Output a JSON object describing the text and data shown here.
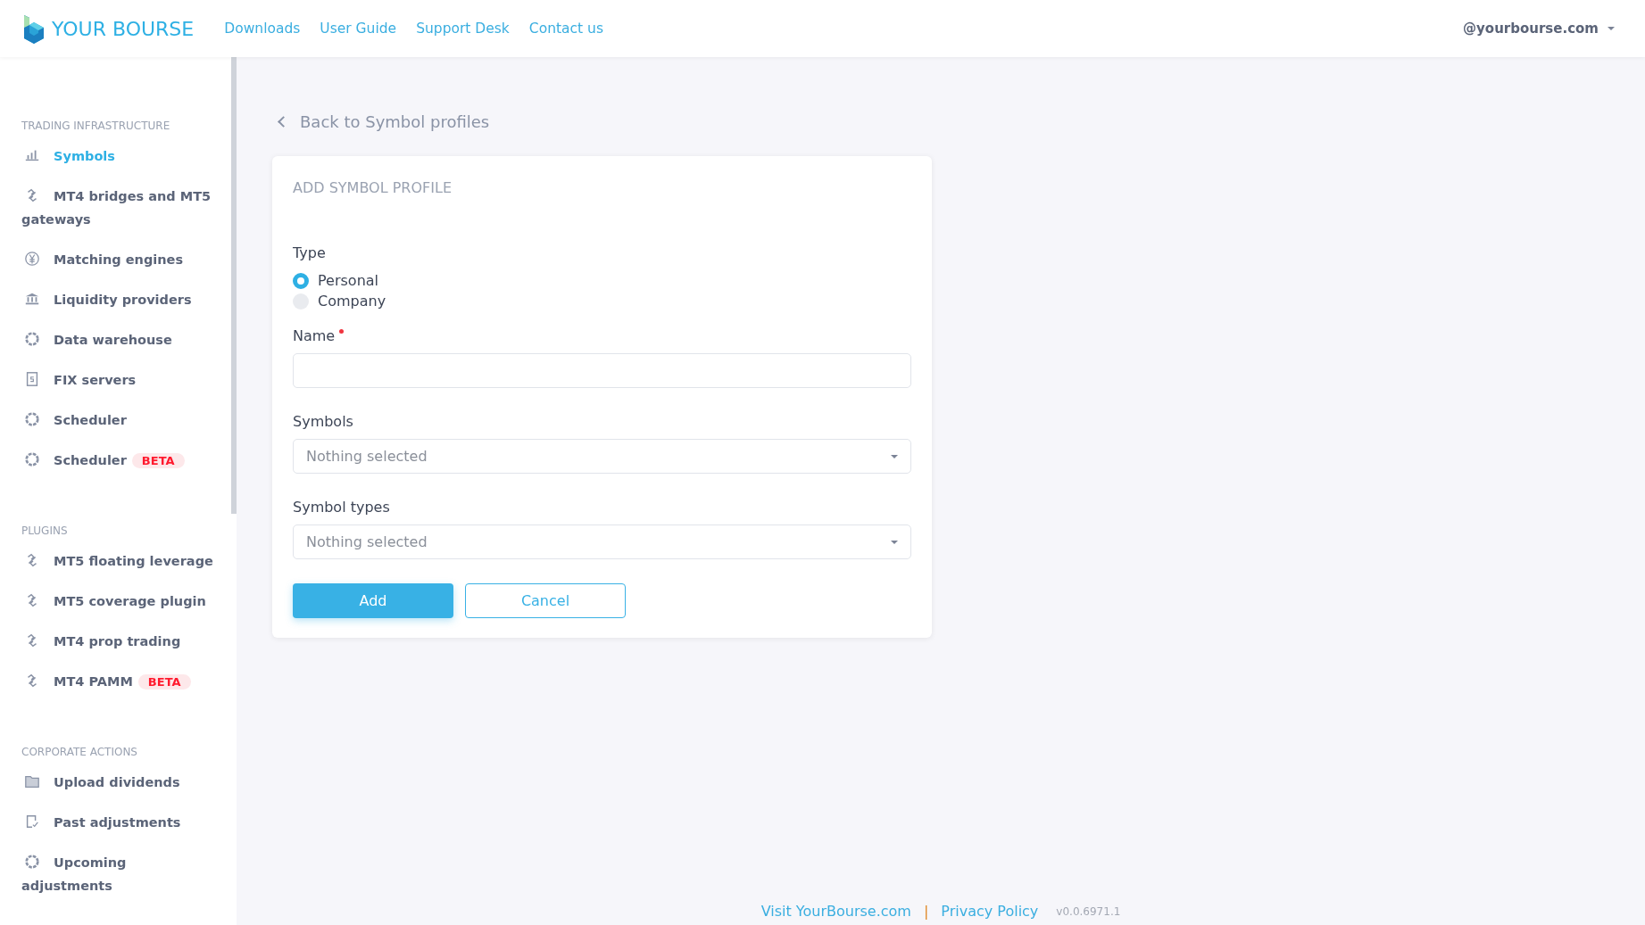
{
  "header": {
    "logo": "YOUR BOURSE",
    "nav": [
      "Downloads",
      "User Guide",
      "Support Desk",
      "Contact us"
    ],
    "account": "@yourbourse.com"
  },
  "sidebar": {
    "sections": [
      {
        "title": "TRADING INFRASTRUCTURE",
        "items": [
          {
            "label": "Symbols",
            "kind": "bars",
            "selected": true
          },
          {
            "label": "MT4 bridges and MT5 gateways",
            "kind": "link",
            "selected": false
          },
          {
            "label": "Matching engines",
            "kind": "yen",
            "selected": false
          },
          {
            "label": "Liquidity providers",
            "kind": "bank",
            "selected": false
          },
          {
            "label": "Data warehouse",
            "kind": "ring",
            "selected": false
          },
          {
            "label": "FIX servers",
            "kind": "doc",
            "selected": false
          },
          {
            "label": "Scheduler",
            "kind": "ring",
            "selected": false
          },
          {
            "label": "Scheduler",
            "kind": "ring",
            "selected": false,
            "badge": "BETA"
          }
        ]
      },
      {
        "title": "PLUGINS",
        "items": [
          {
            "label": "MT5 floating leverage",
            "kind": "link",
            "selected": false
          },
          {
            "label": "MT5 coverage plugin",
            "kind": "link",
            "selected": false
          },
          {
            "label": "MT4 prop trading",
            "kind": "link",
            "selected": false
          },
          {
            "label": "MT4 PAMM",
            "kind": "link",
            "selected": false,
            "badge": "BETA"
          }
        ]
      },
      {
        "title": "CORPORATE ACTIONS",
        "items": [
          {
            "label": "Upload dividends",
            "kind": "folder",
            "selected": false
          },
          {
            "label": "Past adjustments",
            "kind": "checkdoc",
            "selected": false
          },
          {
            "label": "Upcoming adjustments",
            "kind": "ring",
            "selected": false
          }
        ]
      }
    ]
  },
  "back_link": "Back to Symbol profiles",
  "form": {
    "title": "ADD SYMBOL PROFILE",
    "type": {
      "label": "Type",
      "options": [
        {
          "label": "Personal",
          "selected": true
        },
        {
          "label": "Company",
          "selected": false
        }
      ]
    },
    "name": {
      "label": "Name",
      "required": true
    },
    "selects": [
      {
        "label": "Symbols",
        "placeholder": "Nothing selected"
      },
      {
        "label": "Symbol types",
        "placeholder": "Nothing selected"
      }
    ],
    "buttons": [
      {
        "label": "Add",
        "kind": "primary"
      },
      {
        "label": "Cancel",
        "kind": "outline"
      }
    ]
  },
  "footer": {
    "links": [
      "Visit YourBourse.com",
      "Privacy Policy"
    ],
    "separator": "|",
    "version": "v0.0.6971.1"
  }
}
